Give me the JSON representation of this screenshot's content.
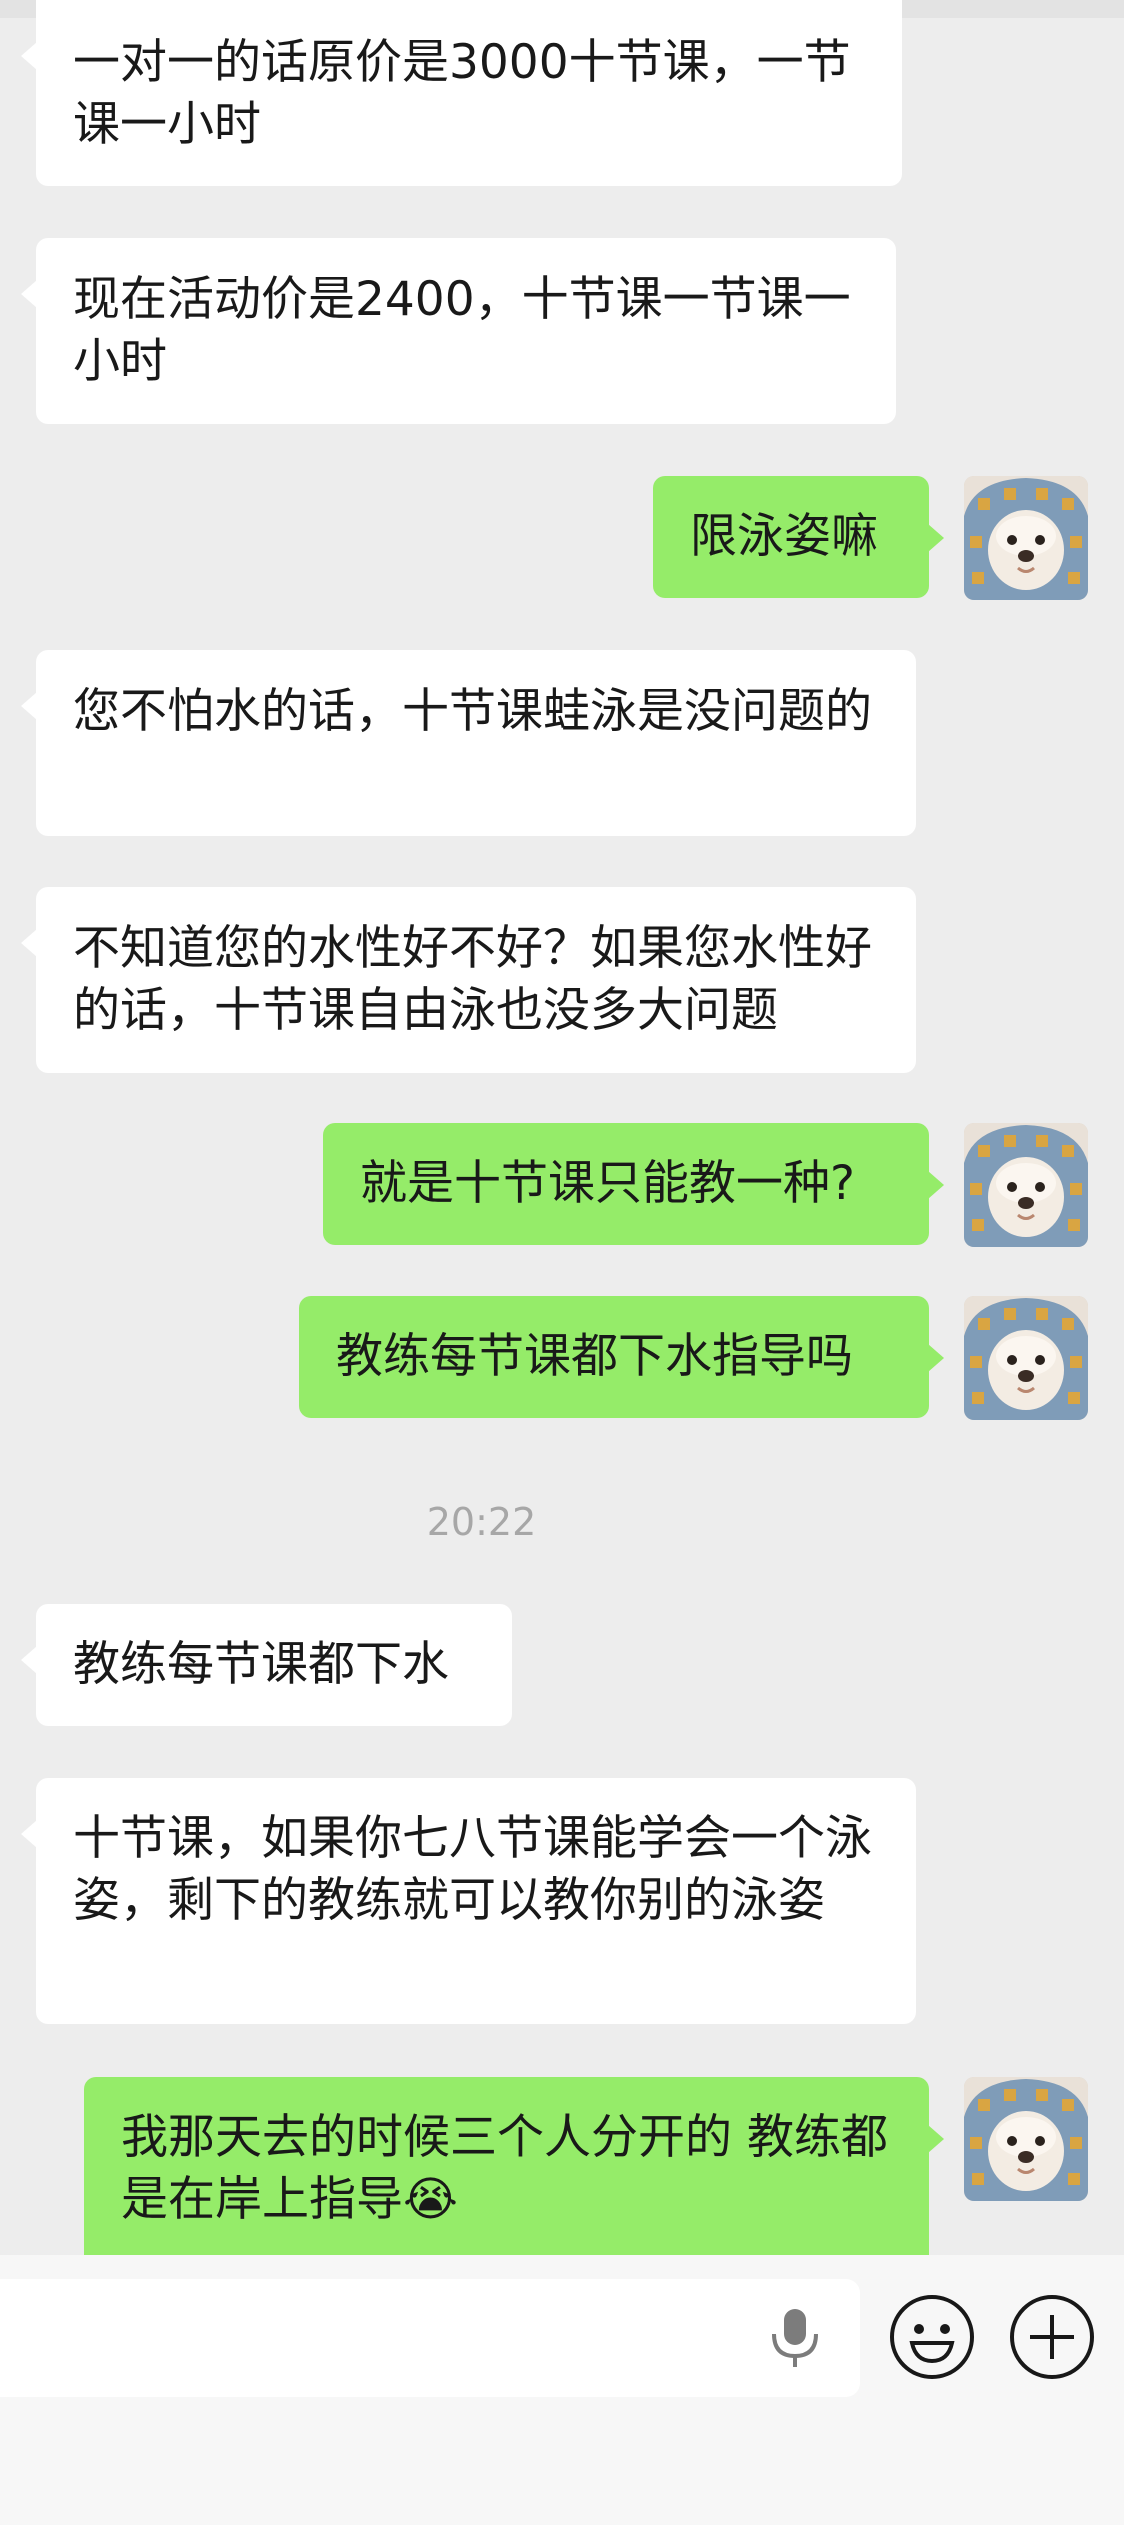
{
  "conversation": {
    "messages": [
      {
        "side": "in",
        "text": "一对一的话原价是3000十节课，一节课一小时"
      },
      {
        "side": "in",
        "text": "现在活动价是2400，十节课一节课一小时"
      },
      {
        "side": "out",
        "text": "限泳姿嘛"
      },
      {
        "side": "in",
        "text": "您不怕水的话，十节课蛙泳是没问题的"
      },
      {
        "side": "in",
        "text": "不知道您的水性好不好？如果您水性好的话，十节课自由泳也没多大问题"
      },
      {
        "side": "out",
        "text": "就是十节课只能教一种?"
      },
      {
        "side": "out",
        "text": "教练每节课都下水指导吗"
      },
      {
        "side": "in",
        "text": "教练每节课都下水"
      },
      {
        "side": "in",
        "text": "十节课，如果你七八节课能学会一个泳姿，剩下的教练就可以教你别的泳姿"
      },
      {
        "side": "out",
        "text": "我那天去的时候三个人分开的 教练都是在岸上指导",
        "emoji": "😭"
      }
    ],
    "timestamp": "20:22"
  },
  "input_bar": {
    "text_value": "",
    "icons": [
      "microphone-icon",
      "emoji-icon",
      "plus-icon"
    ]
  },
  "colors": {
    "background": "#ededed",
    "incoming_bubble": "#ffffff",
    "outgoing_bubble": "#95ec69",
    "text": "#191919",
    "timestamp": "#a7a7a7",
    "input_bar": "#f7f7f7"
  }
}
